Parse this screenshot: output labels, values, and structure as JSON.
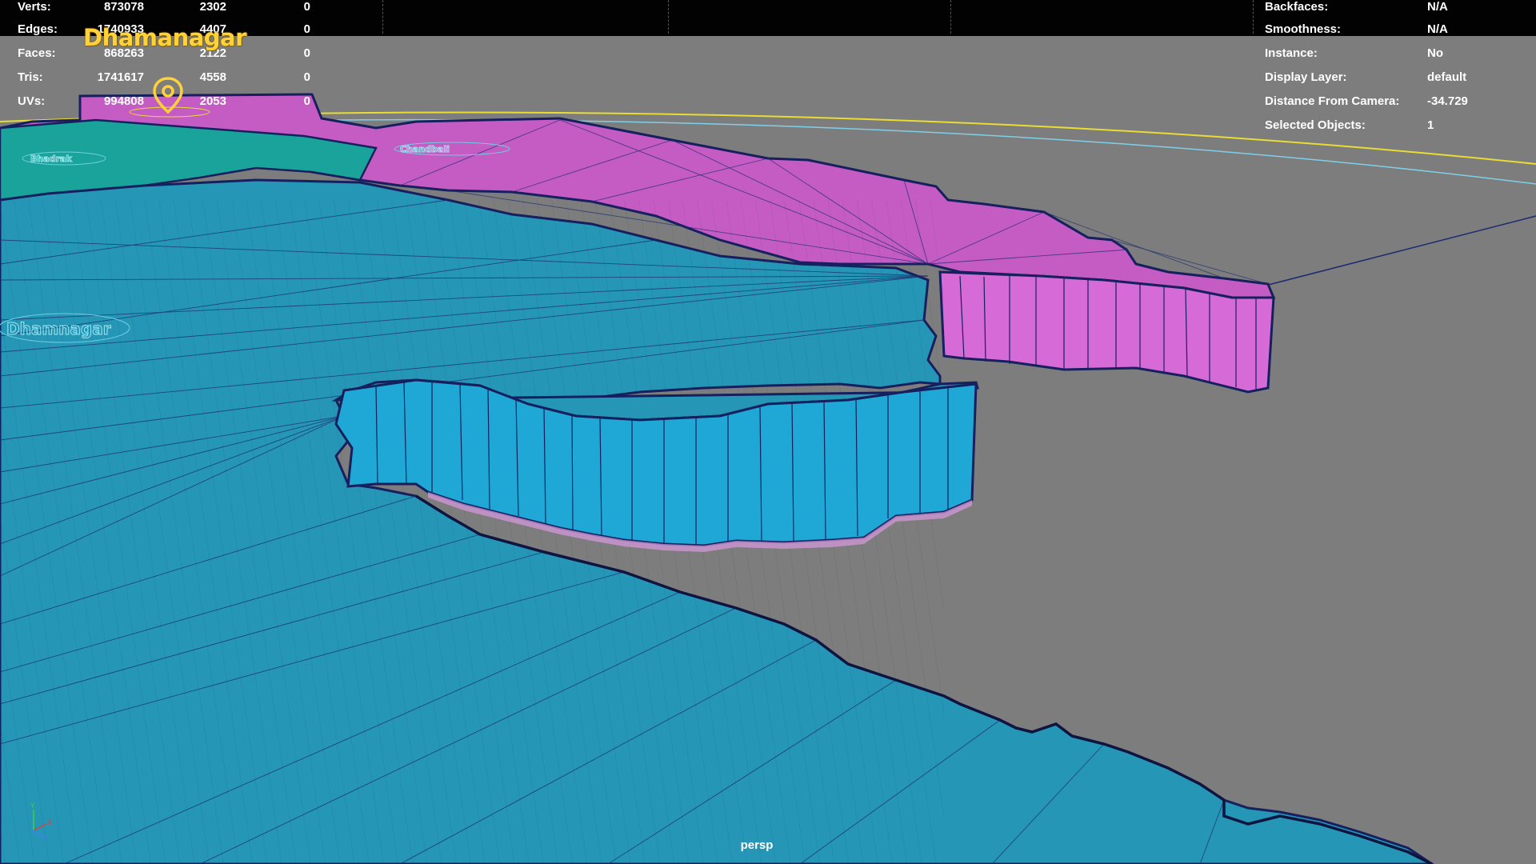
{
  "viewport": {
    "camera_name": "persp",
    "city_label": "Dhamanagar",
    "map_labels": [
      "Bhadrak",
      "Chandbali",
      "Dhamnagar"
    ]
  },
  "stats": {
    "rows": [
      {
        "label": "Verts:",
        "total": "873078",
        "selected": "2302",
        "extra": "0"
      },
      {
        "label": "Edges:",
        "total": "1740933",
        "selected": "4407",
        "extra": "0"
      },
      {
        "label": "Faces:",
        "total": "868263",
        "selected": "2122",
        "extra": "0"
      },
      {
        "label": "Tris:",
        "total": "1741617",
        "selected": "4558",
        "extra": "0"
      },
      {
        "label": "UVs:",
        "total": "994808",
        "selected": "2053",
        "extra": "0"
      }
    ]
  },
  "object_info": {
    "rows": [
      {
        "label": "Backfaces:",
        "value": "N/A"
      },
      {
        "label": "Smoothness:",
        "value": "N/A"
      },
      {
        "label": "Instance:",
        "value": "No"
      },
      {
        "label": "Display Layer:",
        "value": "default"
      },
      {
        "label": "Distance From Camera:",
        "value": "-34.729"
      },
      {
        "label": "Selected Objects:",
        "value": "1"
      }
    ]
  },
  "axis": {
    "y": "Y",
    "x": "X",
    "z": "Z"
  },
  "colors": {
    "background": "#7d7d7d",
    "teal_region": "#1e8fae",
    "teal_top": "#2596b5",
    "magenta_region": "#c45cc4",
    "magenta_wall": "#d66ad6",
    "cyan_wall": "#1fa8d6",
    "wire": "#1b2a6e",
    "label_yellow": "#ffd23a"
  },
  "icons": [
    "map-pin-icon",
    "axis-gizmo-icon"
  ]
}
